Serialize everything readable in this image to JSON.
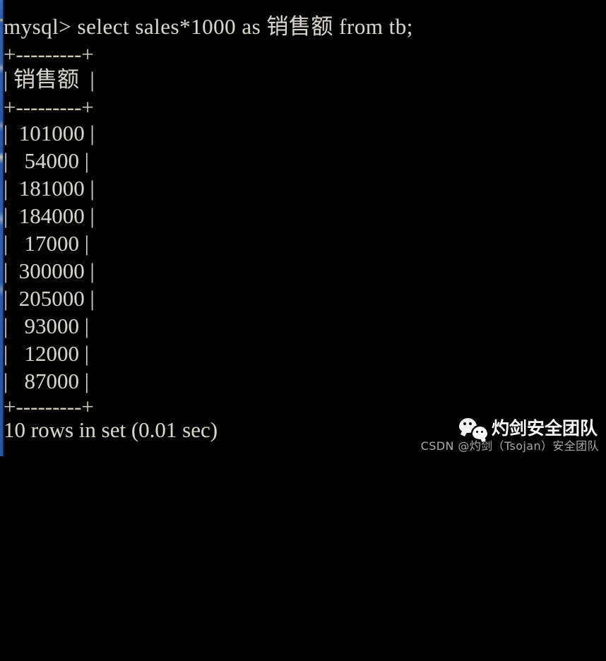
{
  "window": {
    "background_color": "#000000",
    "text_color": "#d6d4cb",
    "edge_accent_color": "#2c5aa1"
  },
  "terminal": {
    "prompt": "mysql> ",
    "query": "select sales*1000 as 销售额 from tb;",
    "prompt_line": "mysql> select sales*1000 as 销售额 from tb;",
    "rule_top": "+---------+",
    "rule_mid": "+---------+",
    "rule_bottom": "+---------+",
    "header_line": "| 销售额  |",
    "column_header": "销售额",
    "rows": [
      {
        "line": "|  101000 |",
        "value": "101000"
      },
      {
        "line": "|   54000 |",
        "value": "54000"
      },
      {
        "line": "|  181000 |",
        "value": "181000"
      },
      {
        "line": "|  184000 |",
        "value": "184000"
      },
      {
        "line": "|   17000 |",
        "value": "17000"
      },
      {
        "line": "|  300000 |",
        "value": "300000"
      },
      {
        "line": "|  205000 |",
        "value": "205000"
      },
      {
        "line": "|   93000 |",
        "value": "93000"
      },
      {
        "line": "|   12000 |",
        "value": "12000"
      },
      {
        "line": "|   87000 |",
        "value": "87000"
      }
    ],
    "status_line": "10 rows in set (0.01 sec)",
    "row_count": "10",
    "elapsed": "0.01 sec"
  },
  "watermark": {
    "icon": "wechat-icon",
    "brand": "灼剑安全团队",
    "credit": "CSDN @灼剑（Tsojan）安全团队"
  }
}
